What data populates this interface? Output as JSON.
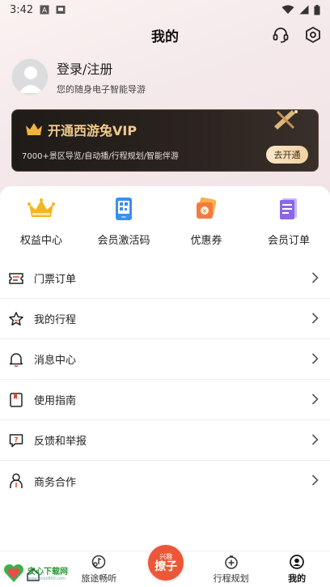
{
  "status_bar": {
    "time": "3:42"
  },
  "header": {
    "title": "我的"
  },
  "profile": {
    "login_label": "登录/注册",
    "subtitle": "您的随身电子智能导游"
  },
  "vip": {
    "title": "开通西游兔VIP",
    "description": "7000+景区导览/自动播/行程规划/智能伴游",
    "button_label": "去开通",
    "accent_color": "#f0c98a"
  },
  "quick_actions": [
    {
      "label": "权益中心",
      "icon": "crown-icon"
    },
    {
      "label": "会员激活码",
      "icon": "activation-code-icon"
    },
    {
      "label": "优惠券",
      "icon": "coupon-icon"
    },
    {
      "label": "会员订单",
      "icon": "order-list-icon"
    }
  ],
  "menu": [
    {
      "label": "门票订单",
      "icon": "ticket-icon"
    },
    {
      "label": "我的行程",
      "icon": "star-icon"
    },
    {
      "label": "消息中心",
      "icon": "bell-icon"
    },
    {
      "label": "使用指南",
      "icon": "guide-book-icon"
    },
    {
      "label": "反馈和举报",
      "icon": "feedback-icon"
    },
    {
      "label": "商务合作",
      "icon": "person-icon"
    }
  ],
  "bottom_nav": {
    "tabs": [
      {
        "label": "",
        "icon": "home-icon"
      },
      {
        "label": "旅途畅听",
        "icon": "listen-icon"
      },
      {
        "label": "",
        "icon": "center-icon"
      },
      {
        "label": "行程规划",
        "icon": "plan-icon"
      },
      {
        "label": "我的",
        "icon": "profile-icon"
      }
    ],
    "center": {
      "top": "兴趣",
      "main": "撩子"
    }
  },
  "watermark": {
    "text": "安心下载网",
    "url": "www.anxz800.com"
  }
}
